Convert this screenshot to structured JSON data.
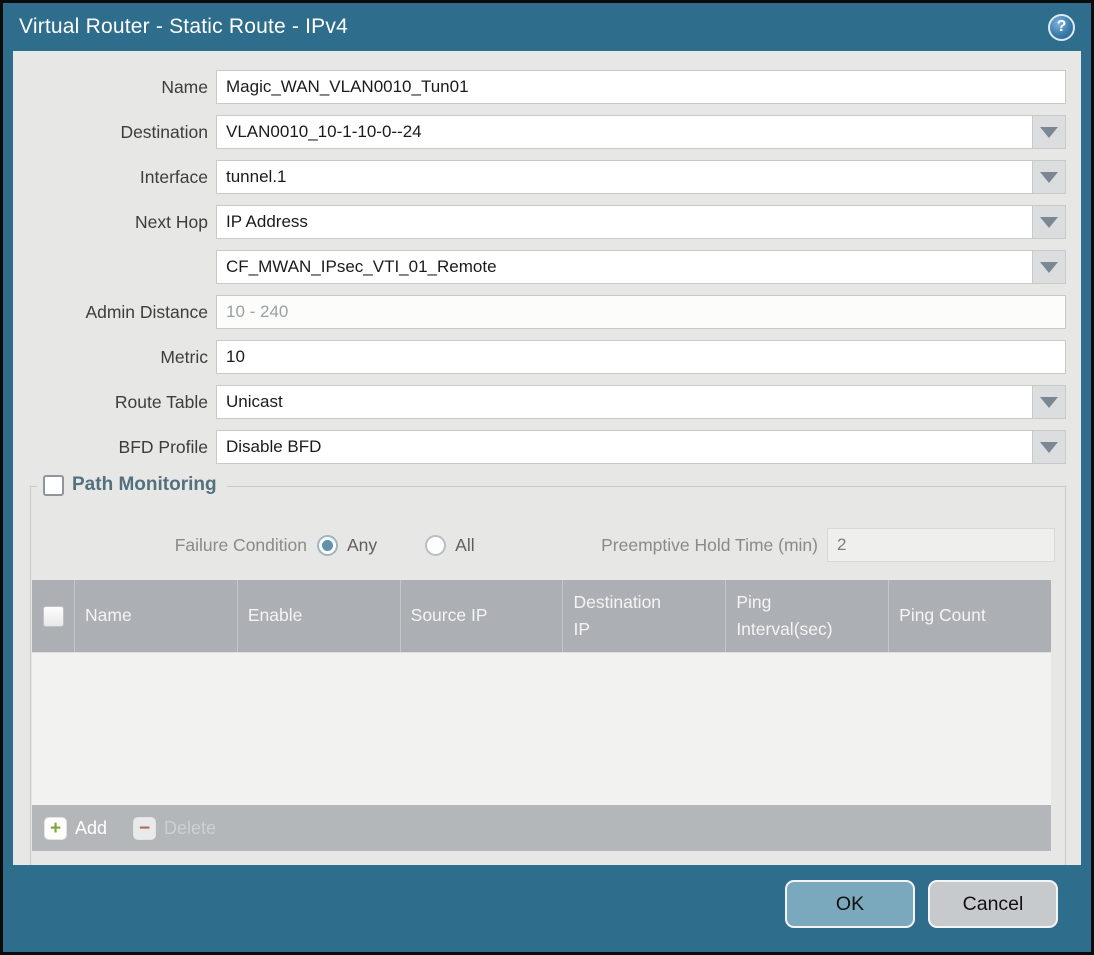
{
  "dialog": {
    "title": "Virtual Router - Static Route - IPv4",
    "help_icon_glyph": "?"
  },
  "form": {
    "name": {
      "label": "Name",
      "value": "Magic_WAN_VLAN0010_Tun01"
    },
    "destination": {
      "label": "Destination",
      "value": "VLAN0010_10-1-10-0--24"
    },
    "interface": {
      "label": "Interface",
      "value": "tunnel.1"
    },
    "next_hop": {
      "label": "Next Hop",
      "value": "IP Address"
    },
    "next_hop_address": {
      "value": "CF_MWAN_IPsec_VTI_01_Remote"
    },
    "admin_distance": {
      "label": "Admin Distance",
      "placeholder": "10 - 240",
      "value": ""
    },
    "metric": {
      "label": "Metric",
      "value": "10"
    },
    "route_table": {
      "label": "Route Table",
      "value": "Unicast"
    },
    "bfd_profile": {
      "label": "BFD Profile",
      "value": "Disable BFD"
    }
  },
  "path_monitoring": {
    "title": "Path Monitoring",
    "checked": false,
    "failure_condition": {
      "label": "Failure Condition",
      "options": [
        {
          "label": "Any",
          "selected": true
        },
        {
          "label": "All",
          "selected": false
        }
      ]
    },
    "preemptive_hold_time": {
      "label": "Preemptive Hold Time (min)",
      "value": "2"
    },
    "table": {
      "columns": [
        "Name",
        "Enable",
        "Source IP",
        "Destination IP",
        "Ping Interval(sec)",
        "Ping Count"
      ],
      "rows": []
    },
    "actions": {
      "add": "Add",
      "delete": "Delete"
    }
  },
  "footer": {
    "ok": "OK",
    "cancel": "Cancel"
  },
  "colors": {
    "frame_teal": "#2E6D8C",
    "content_bg": "#E7E7E5",
    "table_header_gray": "#ACB0B4",
    "table_footer_gray": "#B4B7BA",
    "ok_button": "#7AA8BD",
    "cancel_button": "#C7CACD",
    "radio_selected": "#5E93AB",
    "section_title": "#53707E",
    "add_plus_green": "#7FA53B",
    "delete_minus_red": "#AA6A5E"
  }
}
